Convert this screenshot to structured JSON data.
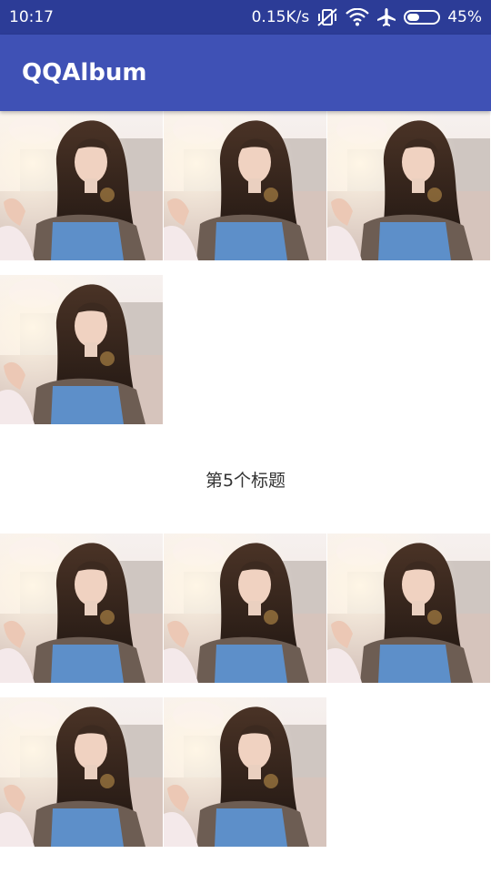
{
  "status_bar": {
    "time": "10:17",
    "network_speed": "0.15K/s",
    "battery_percent": "45%",
    "battery_level": 0.45,
    "icons": [
      "vibrate-off-icon",
      "wifi-icon",
      "airplane-icon",
      "battery-icon"
    ]
  },
  "app_bar": {
    "title": "QQAlbum"
  },
  "gallery": {
    "photo_icon": "portrait-photo",
    "group_1": {
      "photo_count": 4
    },
    "section_title": "第5个标题",
    "group_2": {
      "photo_count": 5
    }
  },
  "colors": {
    "status_bar": "#2c3c97",
    "app_bar": "#3f51b5",
    "background": "#ffffff"
  }
}
